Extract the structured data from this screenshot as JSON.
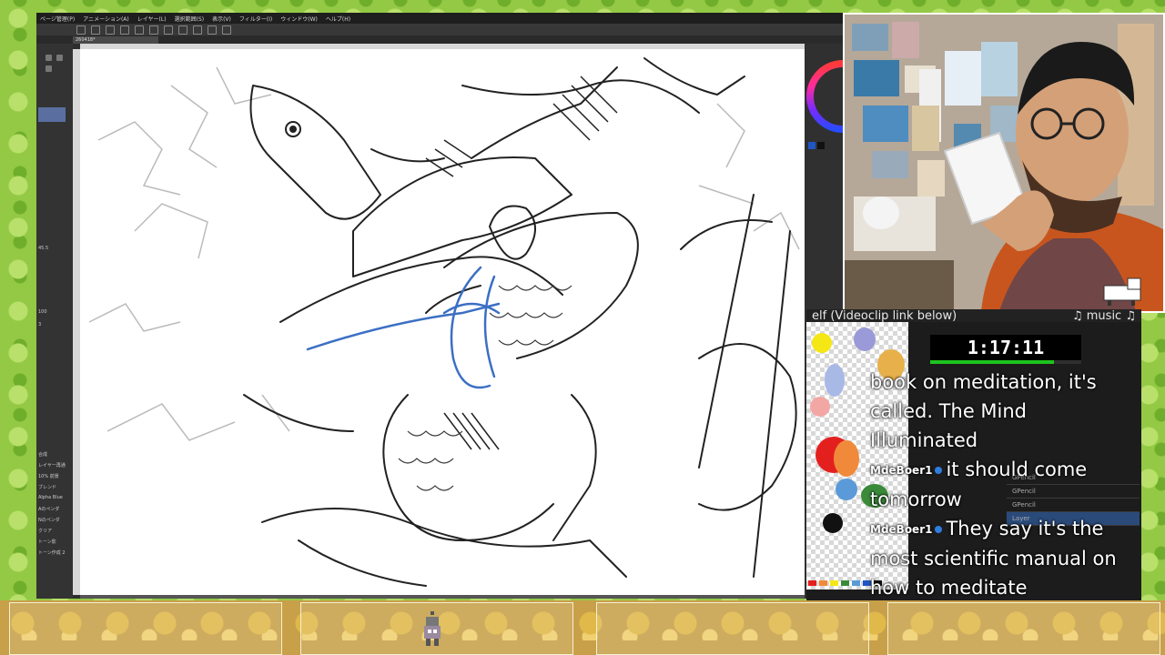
{
  "app": {
    "menu": [
      "ページ管理(P)",
      "アニメーション(A)",
      "レイヤー(L)",
      "選択範囲(S)",
      "表示(V)",
      "フィルター(I)",
      "ウィンドウ(W)",
      "ヘルプ(H)"
    ],
    "tab_label": "260418*",
    "left_panel": {
      "zoom": "45.5",
      "size": "100",
      "value": "3",
      "layer_rows": [
        "合成",
        "レイヤー再通",
        "10% 前景",
        "ブレンド",
        "Alpha Blue",
        "Aのペンダ",
        "Nのペンダ",
        "クリア",
        "トーン影",
        "トーン作成 2"
      ]
    }
  },
  "stream": {
    "ticker_left": "elf (Videoclip link below)",
    "ticker_right": "♫ music ♫",
    "timer": "1:17:11",
    "timer_progress": 0.82
  },
  "chat": {
    "messages": [
      {
        "user": "",
        "text": "book on meditation, it's called. The Mind Illuminated"
      },
      {
        "user": "MdeBoer1",
        "text": "it should come tomorrow"
      },
      {
        "user": "MdeBoer1",
        "text": "They say it's the most scientific manual on how to meditate"
      }
    ],
    "ghost_layers": [
      "GPencil",
      "GPencil",
      "GPencil",
      "Layer"
    ]
  },
  "palette": {
    "colors": [
      "#f5e616",
      "#a9b9e6",
      "#f2a7a4",
      "#e4201f",
      "#f08a3a",
      "#5a9ad8",
      "#3a8a3a",
      "#111111",
      "#9a9ad8",
      "#e8b04a"
    ]
  }
}
